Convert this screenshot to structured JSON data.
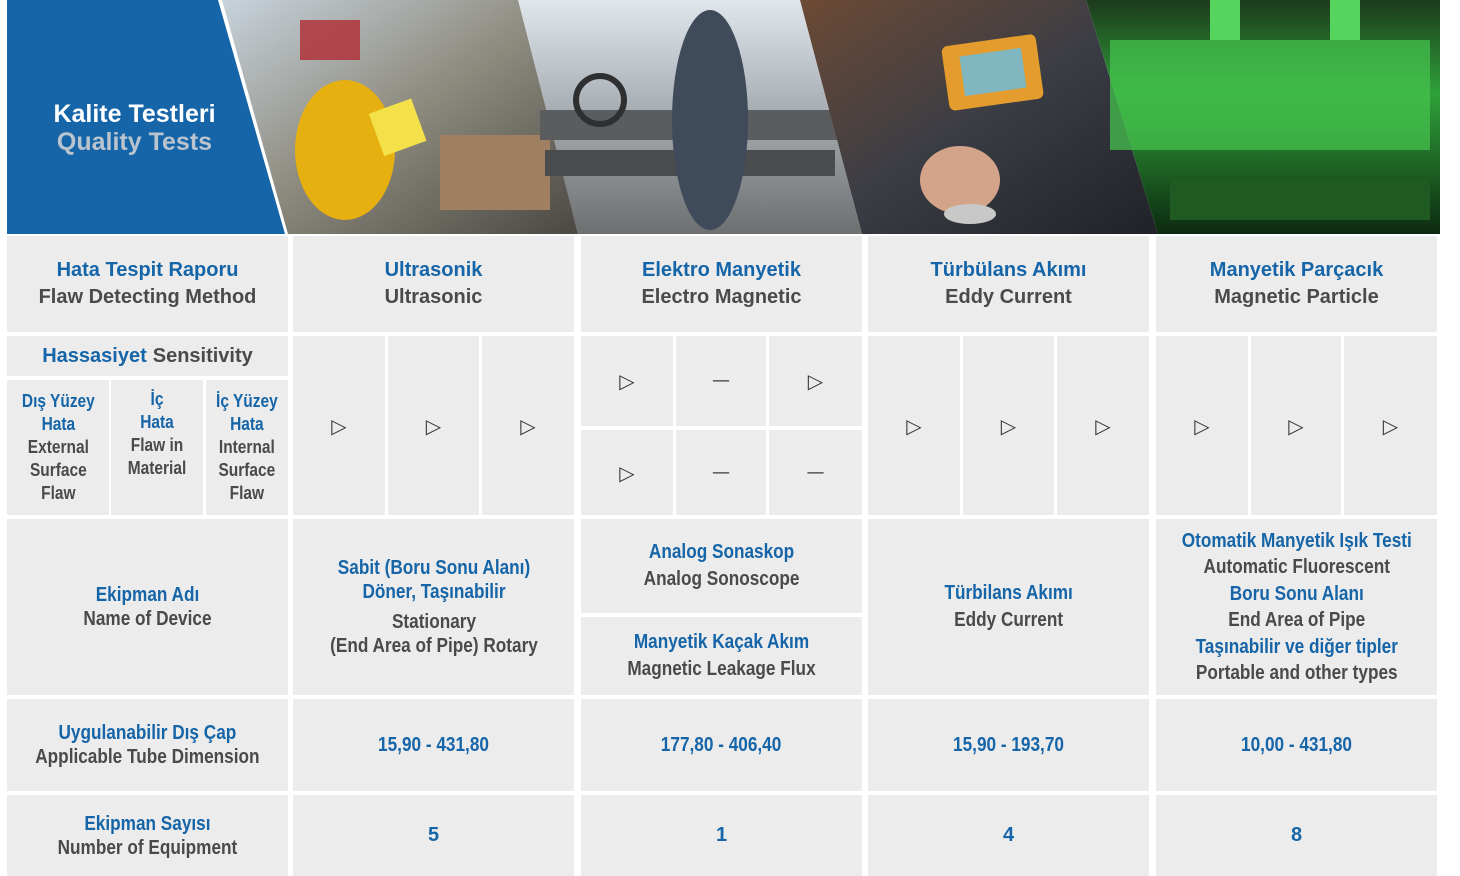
{
  "banner": {
    "title_tr": "Kalite Testleri",
    "title_en": "Quality Tests"
  },
  "colors": {
    "brand_blue": "#1565a8",
    "cell_bg": "#ececec",
    "text_gray": "#4a4a4a"
  },
  "header_row": {
    "label": {
      "tr": "Hata Tespit Raporu",
      "en": "Flaw Detecting Method"
    },
    "methods": [
      {
        "tr": "Ultrasonik",
        "en": "Ultrasonic"
      },
      {
        "tr": "Elektro Manyetik",
        "en": "Electro Magnetic"
      },
      {
        "tr": "Türbülans Akımı",
        "en": "Eddy Current"
      },
      {
        "tr": "Manyetik Parçacık",
        "en": "Magnetic Particle"
      }
    ]
  },
  "sensitivity": {
    "title_tr": "Hassasiyet",
    "title_en": "Sensitivity",
    "sub": [
      {
        "tr1": "Dış Yüzey",
        "tr2": "Hata",
        "en1": "External",
        "en2": "Surface",
        "en3": "Flaw"
      },
      {
        "tr1": "İç",
        "tr2": "Hata",
        "en1": "Flaw in",
        "en2": "Material",
        "en3": ""
      },
      {
        "tr1": "İç Yüzey",
        "tr2": "Hata",
        "en1": "Internal",
        "en2": "Surface",
        "en3": "Flaw"
      }
    ],
    "marks": {
      "ultrasonic": [
        "▷",
        "▷",
        "▷"
      ],
      "electro_top": [
        "▷",
        "—",
        "▷"
      ],
      "electro_bottom": [
        "▷",
        "—",
        "—"
      ],
      "eddy": [
        "▷",
        "▷",
        "▷"
      ],
      "magnetic": [
        "▷",
        "▷",
        "▷"
      ]
    }
  },
  "device_row": {
    "label": {
      "tr": "Ekipman Adı",
      "en": "Name of Device"
    },
    "ultrasonic": {
      "tr": "Sabit (Boru Sonu Alanı) Döner, Taşınabilir",
      "en1": "Stationary",
      "en2": "(End Area of Pipe) Rotary"
    },
    "electro_top": {
      "tr": "Analog Sonaskop",
      "en": "Analog Sonoscope"
    },
    "electro_bottom": {
      "tr": "Manyetik Kaçak Akım",
      "en": "Magnetic Leakage Flux"
    },
    "eddy": {
      "tr": "Türbilans Akımı",
      "en": "Eddy Current"
    },
    "magnetic": {
      "tr1": "Otomatik Manyetik Işık Testi",
      "en1": "Automatic Fluorescent",
      "tr2": "Boru Sonu Alanı",
      "en2": "End Area of Pipe",
      "tr3": "Taşınabilir ve diğer tipler",
      "en3": "Portable and other types"
    }
  },
  "dimension_row": {
    "label": {
      "tr": "Uygulanabilir Dış Çap",
      "en": "Applicable Tube Dimension"
    },
    "values": [
      "15,90 - 431,80",
      "177,80 - 406,40",
      "15,90 - 193,70",
      "10,00 - 431,80"
    ]
  },
  "count_row": {
    "label": {
      "tr": "Ekipman Sayısı",
      "en": "Number of Equipment"
    },
    "values": [
      "5",
      "1",
      "4",
      "8"
    ]
  }
}
